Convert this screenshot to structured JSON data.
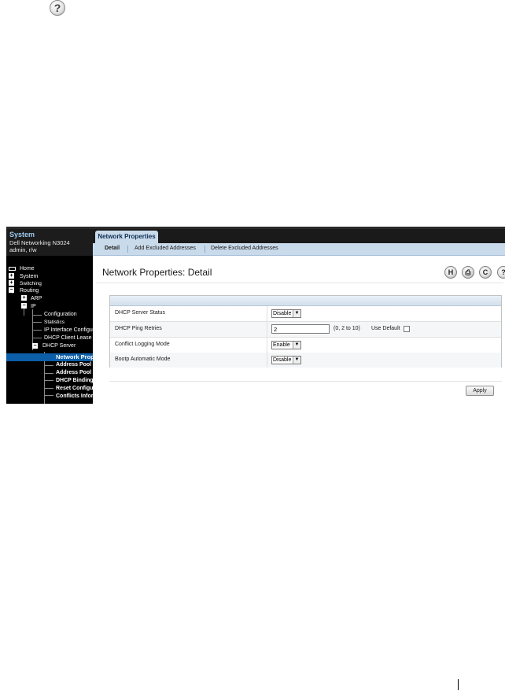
{
  "nav": {
    "title": "System",
    "model": "Dell Networking N3024",
    "user": "admin, r/w",
    "items": [
      {
        "label": "Home"
      },
      {
        "label": "System"
      },
      {
        "label": "Switching"
      },
      {
        "label": "Routing"
      },
      {
        "label": "ARP"
      },
      {
        "label": "IP"
      },
      {
        "label": "Configuration"
      },
      {
        "label": "Statistics"
      },
      {
        "label": "IP Interface Configu"
      },
      {
        "label": "DHCP Client Lease"
      },
      {
        "label": "DHCP Server"
      },
      {
        "label": "Network Prop"
      },
      {
        "label": "Address Pool"
      },
      {
        "label": "Address Pool C"
      },
      {
        "label": "DHCP Bindings"
      },
      {
        "label": "Reset Configur"
      },
      {
        "label": "Conflicts Inform"
      }
    ]
  },
  "tabs": {
    "active": "Network Properties"
  },
  "subtabs": [
    {
      "label": "Detail",
      "active": true
    },
    {
      "label": "Add Excluded Addresses",
      "active": false
    },
    {
      "label": "Delete Excluded Addresses",
      "active": false
    }
  ],
  "page": {
    "title": "Network Properties: Detail"
  },
  "toolbar": {
    "icons": [
      "save-icon",
      "print-icon",
      "refresh-icon",
      "help-icon"
    ],
    "glyphs": [
      "H",
      "⎙",
      "C",
      "?"
    ]
  },
  "form": {
    "rows": [
      {
        "label": "DHCP Server Status",
        "value": "Disable"
      },
      {
        "label": "DHCP Ping Retries",
        "value": "2",
        "range": "(0, 2 to 10)",
        "use_default": "Use Default"
      },
      {
        "label": "Conflict Logging Mode",
        "value": "Enable"
      },
      {
        "label": "Bootp Automatic Mode",
        "value": "Disable"
      }
    ]
  },
  "apply_label": "Apply",
  "help_glyph": "?"
}
